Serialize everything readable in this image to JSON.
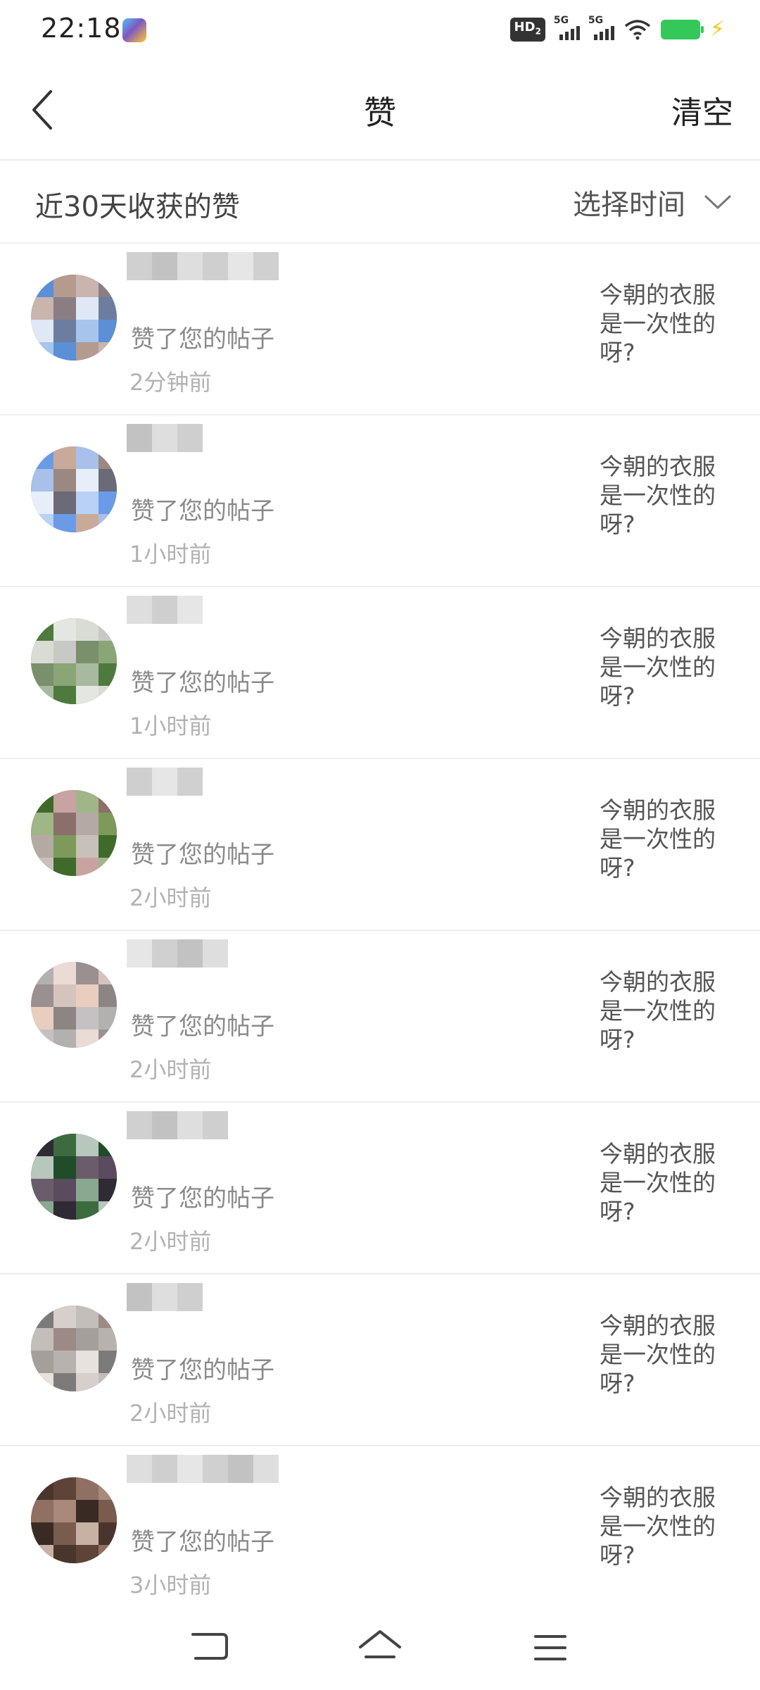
{
  "status_bar": {
    "time": "22:18",
    "hd_badge": "HD",
    "hd_sub": "2",
    "signal1_label": "5G",
    "signal2_label": "5G",
    "icons": [
      "app-notification-icon",
      "wifi-icon",
      "battery-icon",
      "charging-icon"
    ],
    "battery_color": "#34c759"
  },
  "header": {
    "title": "赞",
    "clear_label": "清空",
    "back_icon": "chevron-left-icon"
  },
  "filter": {
    "label": "近30天收获的赞",
    "select_label": "选择时间",
    "select_icon": "chevron-down-icon"
  },
  "likes": [
    {
      "action": "赞了您的帖子",
      "time": "2分钟前",
      "post": "今朝的衣服是一次性的呀?"
    },
    {
      "action": "赞了您的帖子",
      "time": "1小时前",
      "post": "今朝的衣服是一次性的呀?"
    },
    {
      "action": "赞了您的帖子",
      "time": "1小时前",
      "post": "今朝的衣服是一次性的呀?"
    },
    {
      "action": "赞了您的帖子",
      "time": "2小时前",
      "post": "今朝的衣服是一次性的呀?"
    },
    {
      "action": "赞了您的帖子",
      "time": "2小时前",
      "post": "今朝的衣服是一次性的呀?"
    },
    {
      "action": "赞了您的帖子",
      "time": "2小时前",
      "post": "今朝的衣服是一次性的呀?"
    },
    {
      "action": "赞了您的帖子",
      "time": "2小时前",
      "post": "今朝的衣服是一次性的呀?"
    },
    {
      "action": "赞了您的帖子",
      "time": "3小时前",
      "post": "今朝的衣服是一次性的呀?"
    }
  ],
  "nav_bar": {
    "icons": [
      "back-nav-icon",
      "home-icon",
      "menu-icon"
    ]
  }
}
